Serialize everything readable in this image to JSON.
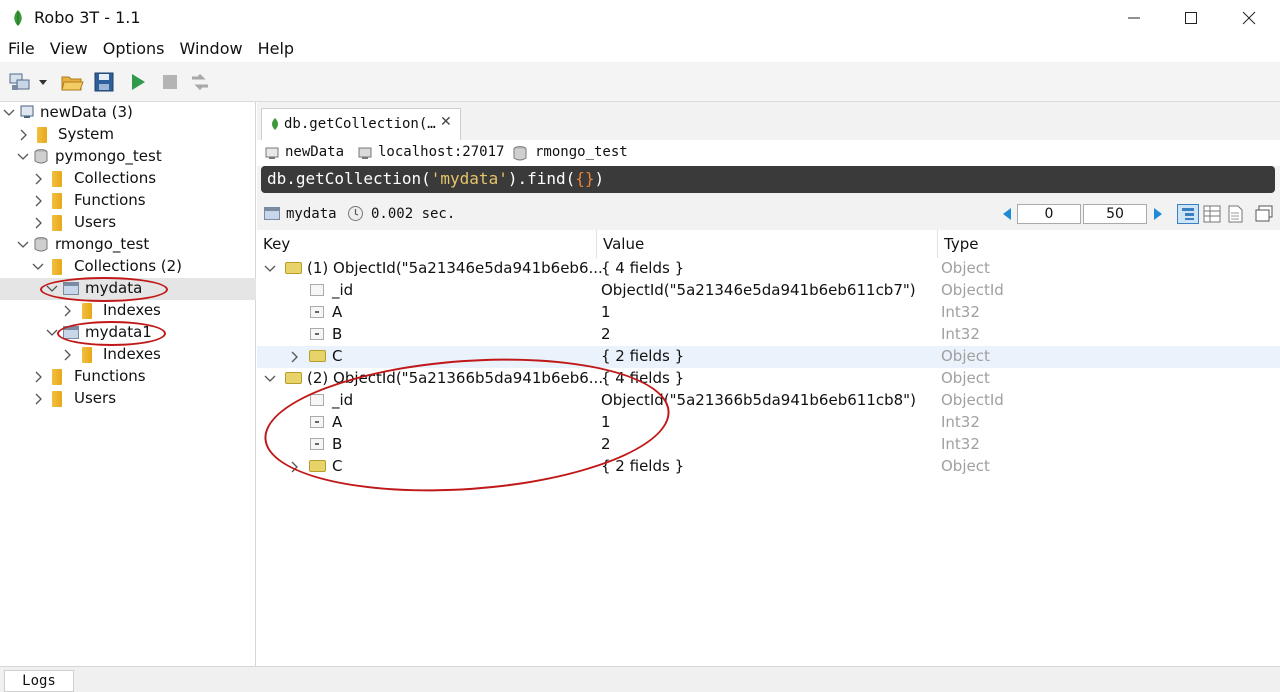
{
  "window": {
    "title": "Robo 3T - 1.1"
  },
  "menu": [
    "File",
    "View",
    "Options",
    "Window",
    "Help"
  ],
  "tree": {
    "connection": "newData (3)",
    "system": "System",
    "db1": {
      "name": "pymongo_test",
      "collections": "Collections",
      "functions": "Functions",
      "users": "Users"
    },
    "db2": {
      "name": "rmongo_test",
      "collections": "Collections (2)",
      "coll1": "mydata",
      "coll1_indexes": "Indexes",
      "coll2": "mydata1",
      "coll2_indexes": "Indexes",
      "functions": "Functions",
      "users": "Users"
    }
  },
  "tab": {
    "label": "db.getCollection(…"
  },
  "breadcrumb": {
    "connection": "newData",
    "server": "localhost:27017",
    "database": "rmongo_test"
  },
  "query": {
    "prefix": "db.getCollection(",
    "arg": "'mydata'",
    "mid": ").find(",
    "braces": "{}",
    "suffix": ")"
  },
  "result_bar": {
    "collection": "mydata",
    "time": "0.002 sec.",
    "page_start": "0",
    "page_size": "50"
  },
  "columns": [
    "Key",
    "Value",
    "Type"
  ],
  "rows": [
    {
      "key": "(1) ObjectId(\"5a21346e5da941b6eb6...",
      "value": "{ 4 fields }",
      "type": "Object"
    },
    {
      "key": "_id",
      "value": "ObjectId(\"5a21346e5da941b6eb611cb7\")",
      "type": "ObjectId"
    },
    {
      "key": "A",
      "value": "1",
      "type": "Int32"
    },
    {
      "key": "B",
      "value": "2",
      "type": "Int32"
    },
    {
      "key": "C",
      "value": "{ 2 fields }",
      "type": "Object"
    },
    {
      "key": "(2) ObjectId(\"5a21366b5da941b6eb6...",
      "value": "{ 4 fields }",
      "type": "Object"
    },
    {
      "key": "_id",
      "value": "ObjectId(\"5a21366b5da941b6eb611cb8\")",
      "type": "ObjectId"
    },
    {
      "key": "A",
      "value": "1",
      "type": "Int32"
    },
    {
      "key": "B",
      "value": "2",
      "type": "Int32"
    },
    {
      "key": "C",
      "value": "{ 2 fields }",
      "type": "Object"
    }
  ],
  "logs": {
    "label": "Logs"
  },
  "colors": {
    "accent": "#1f8bd6",
    "annotation": "#c01818",
    "selected_row": "#e5e5e5",
    "highlight_row": "#eaf2fb"
  }
}
